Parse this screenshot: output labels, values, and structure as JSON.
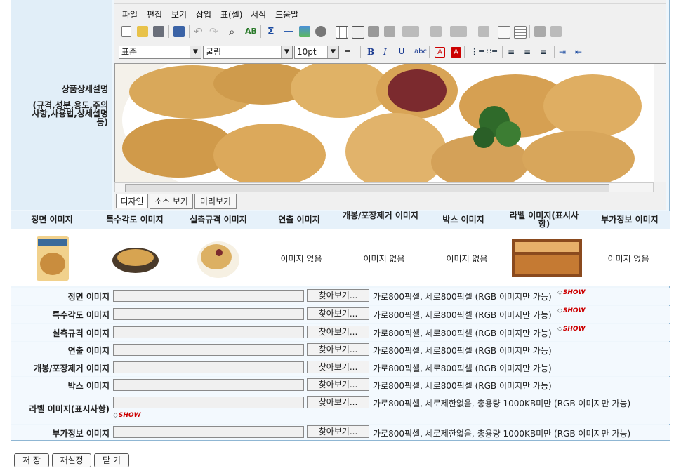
{
  "editor_section": {
    "label_title": "상품상세설명",
    "label_sub": "(규격,성분,용도,주의사항,사용법,상세설명 등)",
    "menu": [
      "파일",
      "편집",
      "보기",
      "삽입",
      "표(셀)",
      "서식",
      "도움말"
    ],
    "style_select": "표준",
    "font_select": "굴림",
    "size_select": "10pt",
    "tabs": [
      "디자인",
      "소스 보기",
      "미리보기"
    ],
    "active_tab": "디자인"
  },
  "image_header": [
    "정면 이미지",
    "특수각도 이미지",
    "실측규격 이미지",
    "연출 이미지",
    "개봉/포장제거 이미지",
    "박스 이미지",
    "라벨 이미지(표시사항)",
    "부가정보 이미지"
  ],
  "image_cells": [
    "",
    "",
    "",
    "이미지 없음",
    "이미지 없음",
    "이미지 없음",
    "",
    "이미지 없음"
  ],
  "file_rows": [
    {
      "label": "정면 이미지",
      "button": "찾아보기...",
      "hint": "가로800픽셀, 세로800픽셀 (RGB 이미지만 가능)",
      "show": "SHOW"
    },
    {
      "label": "특수각도 이미지",
      "button": "찾아보기...",
      "hint": "가로800픽셀, 세로800픽셀 (RGB 이미지만 가능)",
      "show": "SHOW"
    },
    {
      "label": "실측규격 이미지",
      "button": "찾아보기...",
      "hint": "가로800픽셀, 세로800픽셀 (RGB 이미지만 가능)",
      "show": "SHOW"
    },
    {
      "label": "연출 이미지",
      "button": "찾아보기...",
      "hint": "가로800픽셀, 세로800픽셀 (RGB 이미지만 가능)",
      "show": ""
    },
    {
      "label": "개봉/포장제거 이미지",
      "button": "찾아보기...",
      "hint": "가로800픽셀, 세로800픽셀 (RGB 이미지만 가능)",
      "show": ""
    },
    {
      "label": "박스 이미지",
      "button": "찾아보기...",
      "hint": "가로800픽셀, 세로800픽셀 (RGB 이미지만 가능)",
      "show": ""
    },
    {
      "label": "라벨 이미지(표시사항)",
      "button": "찾아보기...",
      "hint": "가로800픽셀, 세로제한없음, 총용량 1000KB미만 (RGB 이미지만 가능)",
      "show": "SHOW"
    },
    {
      "label": "부가정보 이미지",
      "button": "찾아보기...",
      "hint": "가로800픽셀, 세로제한없음, 총용량 1000KB미만 (RGB 이미지만 가능)",
      "show": ""
    }
  ],
  "footer_buttons": {
    "save": "저 장",
    "reset": "재설정",
    "close": "닫 기"
  },
  "colors": {
    "accent_border": "#8fb6d3",
    "label_bg": "#e1eef8",
    "show_red": "#cc0000"
  }
}
